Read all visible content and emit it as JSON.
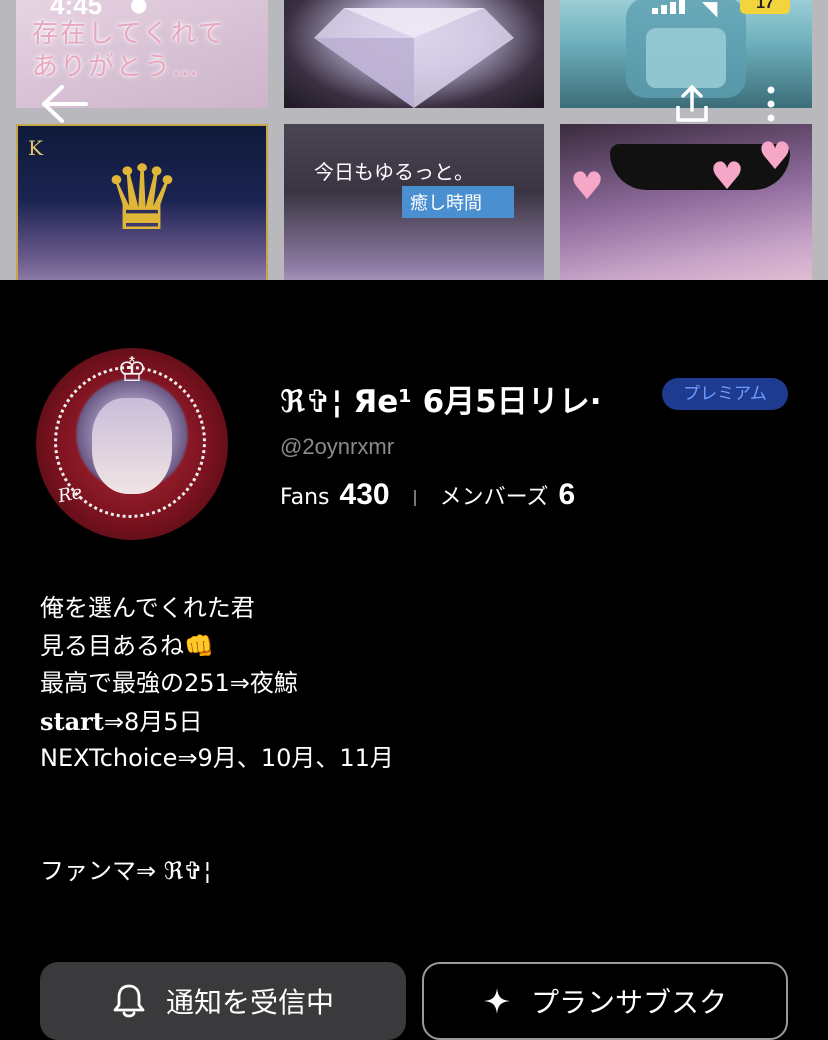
{
  "status_bar": {
    "time": "4:45",
    "battery": "17"
  },
  "header": {
    "tile_texts": {
      "tile1": "存在してくれて\nありがとう…",
      "tile4_letter": "K",
      "tile5_line1": "今日もゆるっと。",
      "tile5_line2": "癒し時間"
    }
  },
  "profile": {
    "name": "ℜ✞¦ Яe¹ 6月5日リレ·",
    "badge": "プレミアム",
    "handle": "@2oynrxmr",
    "stats": {
      "fans_label": "Fans",
      "fans_value": "430",
      "members_label": "メンバーズ",
      "members_value": "6"
    }
  },
  "bio": {
    "lines": [
      "俺を選んでくれた君",
      "見る目あるね👊",
      "最高で最強の251⇒夜鯨",
      "start",
      "⇒8月5日",
      "NEXTchoice⇒9月、10月、11月",
      "ファンマ⇒ ℜ✞¦"
    ]
  },
  "buttons": {
    "notify_label": "通知を受信中",
    "plan_label": "プランサブスク"
  },
  "icons": {
    "back": "arrow-left-icon",
    "share": "share-icon",
    "more": "more-vertical-icon",
    "notify": "bell-icon",
    "plan": "sparkle-icon"
  },
  "colors": {
    "background": "#000000",
    "badge_bg": "#1f3b8f",
    "badge_text": "#6e9cff",
    "handle": "#8a8a8e",
    "notify_button": "#3a3a3c"
  }
}
